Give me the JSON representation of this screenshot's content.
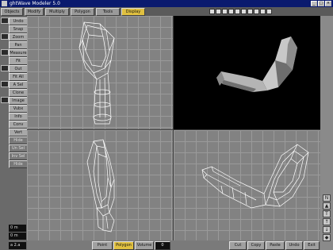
{
  "window": {
    "title": "ghtWave Modeler 5.0"
  },
  "top_tabs": [
    {
      "label": "Objects",
      "active": false
    },
    {
      "label": "Modify",
      "active": false
    },
    {
      "label": "Multiply",
      "active": false
    },
    {
      "label": "Polygon",
      "active": false
    },
    {
      "label": "Tools",
      "active": false
    },
    {
      "label": "Display",
      "active": true
    }
  ],
  "layer_count": 10,
  "left_tools": [
    "Undo",
    "Snap",
    "Zoom",
    "Pan",
    "Measure",
    "Fit",
    "Out",
    "Fit All",
    "A Sel",
    "Clone",
    "Image",
    "Vubx",
    "Info",
    "Conv",
    "Vert",
    "Hide",
    "Un Sel",
    "Inv Sel",
    "Hide"
  ],
  "readouts": [
    "0 m",
    "0 m",
    "a 2.a"
  ],
  "bottom_bar": {
    "point_label": "Point",
    "polygon_label": "Polygon",
    "volume_label": "Volume",
    "volume_value": "0",
    "cut_label": "Cut",
    "copy_label": "Copy",
    "paste_label": "Paste",
    "undo_label": "Undo",
    "exit_label": "Exit"
  },
  "right_icons": [
    "numeric",
    "paint",
    "text",
    "arrow-up",
    "arrow-down",
    "shape"
  ],
  "colors": {
    "title_bg": "#0a1a6e",
    "active_tab": "#e0c040",
    "viewport": "#828282",
    "wire": "#ffffff",
    "perspective_bg": "#000000"
  }
}
